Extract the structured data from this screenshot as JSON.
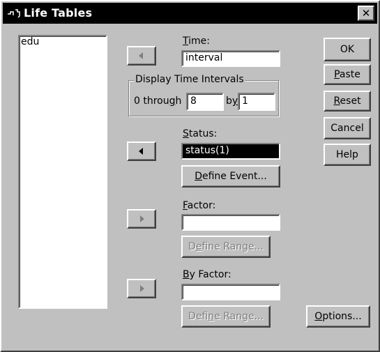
{
  "window": {
    "title": "Life Tables",
    "close_glyph": "✕"
  },
  "variables": {
    "items": [
      "edu"
    ]
  },
  "time": {
    "label_key": "T",
    "label_rest": "ime:",
    "value": "interval"
  },
  "display_intervals": {
    "title": "Display Time Intervals",
    "through_prefix": "0 throu",
    "through_key": "g",
    "through_suffix": "h",
    "through_value": "8",
    "by_prefix": "b",
    "by_key": "y",
    "by_value": "1"
  },
  "status": {
    "label_key": "S",
    "label_rest": "tatus:",
    "value": "status(1)"
  },
  "define_event": {
    "key": "D",
    "rest": "efine Event..."
  },
  "factor": {
    "label_key": "F",
    "label_rest": "actor:",
    "value": ""
  },
  "define_range_1": {
    "pre": "D",
    "key": "e",
    "rest": "fine Range..."
  },
  "by_factor": {
    "label_key": "B",
    "label_rest": "y Factor:",
    "value": ""
  },
  "define_range_2": {
    "pre": "Defi",
    "key": "n",
    "rest": "e Range..."
  },
  "buttons": {
    "ok": "OK",
    "paste_key": "P",
    "paste_rest": "aste",
    "reset_key": "R",
    "reset_rest": "eset",
    "cancel": "Cancel",
    "help": "Help",
    "options_key": "O",
    "options_rest": "ptions..."
  },
  "icons": {
    "app": "life-tables-icon",
    "arrow_left": "arrow-left-icon",
    "arrow_right": "arrow-right-icon"
  },
  "colors": {
    "face": "#c0c0c0",
    "titlebar": "#000000",
    "selection": "#000000",
    "disabled_text": "#808080"
  }
}
